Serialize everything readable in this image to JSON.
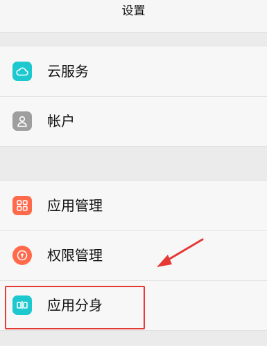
{
  "header": {
    "title": "设置"
  },
  "groups": [
    {
      "items": [
        {
          "label": "云服务",
          "icon": "cloud-icon",
          "color": "#1ec8cf"
        },
        {
          "label": "帐户",
          "icon": "user-icon",
          "color": "#9e9e9e"
        }
      ]
    },
    {
      "items": [
        {
          "label": "应用管理",
          "icon": "grid-icon",
          "color": "#ff6a4d"
        },
        {
          "label": "权限管理",
          "icon": "lock-icon",
          "color": "#ff6a4d"
        },
        {
          "label": "应用分身",
          "icon": "app-twin-icon",
          "color": "#1ec8cf"
        }
      ]
    }
  ],
  "annotation": {
    "highlight_color": "#e53935"
  }
}
